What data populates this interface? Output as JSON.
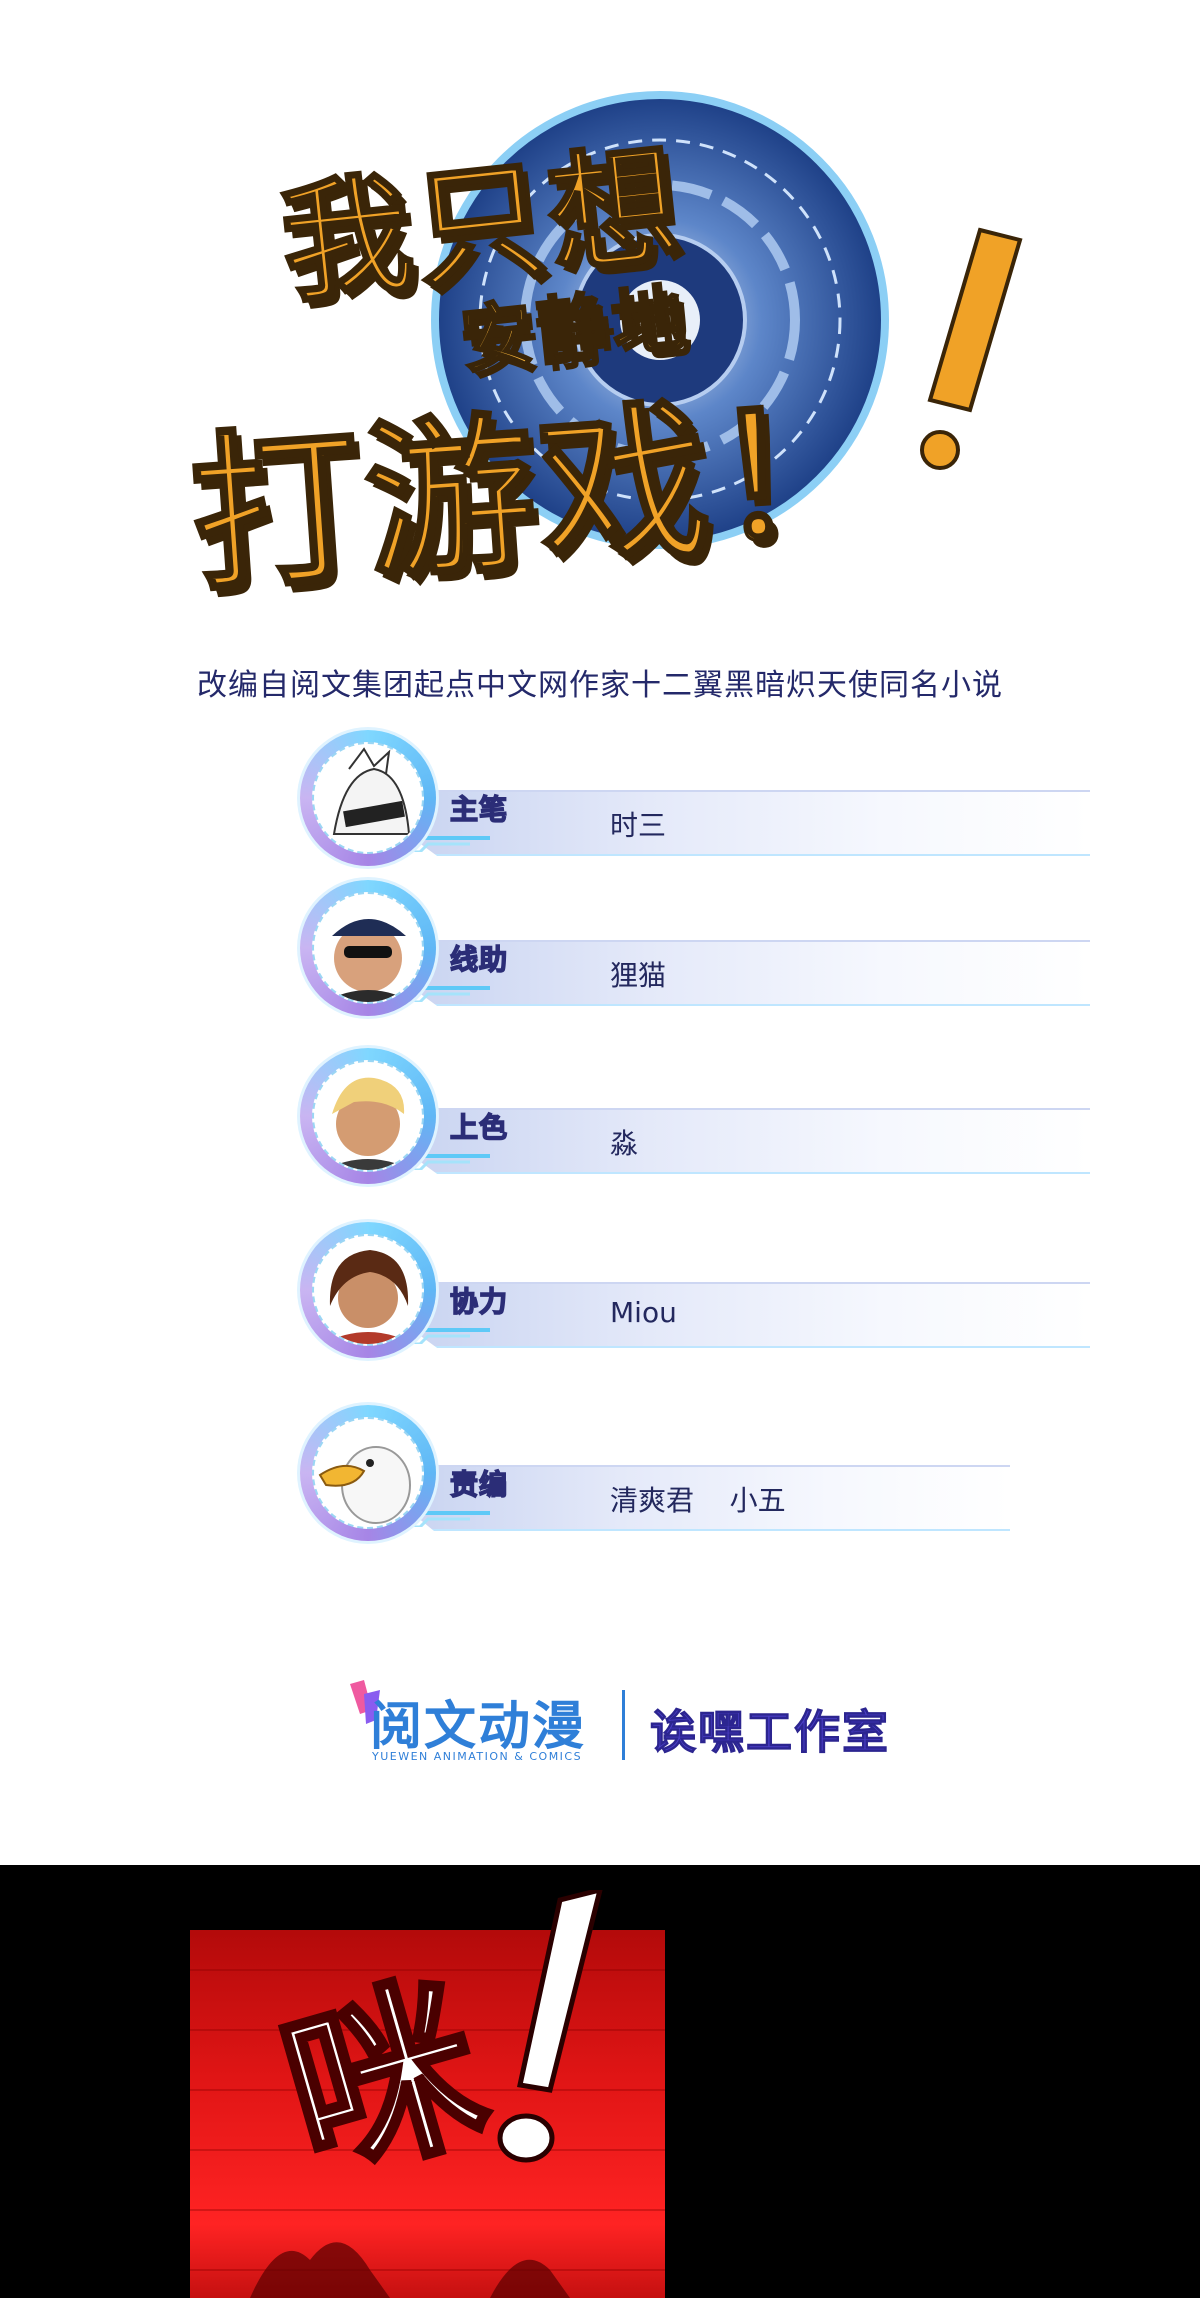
{
  "logo": {
    "line1": "我只想",
    "line2": "安静地",
    "line3": "打游戏！"
  },
  "subtitle": "改编自阅文集团起点中文网作家十二翼黑暗炽天使同名小说",
  "credits": [
    {
      "role": "主笔",
      "name": "时三",
      "avatar_icon": "sketch-character-avatar"
    },
    {
      "role": "线助",
      "name": "狸猫",
      "avatar_icon": "cap-sunglasses-avatar"
    },
    {
      "role": "上色",
      "name": "淼",
      "avatar_icon": "blonde-man-avatar"
    },
    {
      "role": "协力",
      "name": "Miou",
      "avatar_icon": "brown-hair-avatar"
    },
    {
      "role": "责编",
      "name": "清爽君    小五",
      "avatar_icon": "goose-avatar"
    }
  ],
  "publisher": {
    "name": "阅文动漫",
    "tagline": "YUEWEN ANIMATION & COMICS",
    "studio": "诶嘿工作室"
  },
  "panel": {
    "sound_effect": "咪",
    "exclamation": "！"
  },
  "colors": {
    "logo_gold": "#f0a227",
    "ring_blue": "#2f5fae",
    "text_navy": "#24296a",
    "publisher_blue": "#2f7fd8",
    "studio_purple": "#4a3ec6",
    "panel_red": "#e01515"
  }
}
